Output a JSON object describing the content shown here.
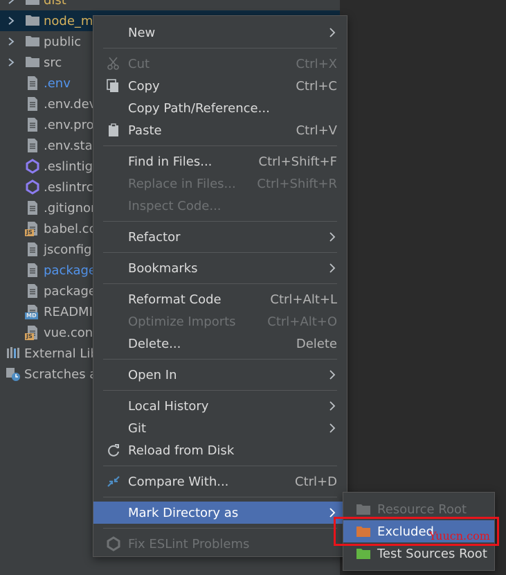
{
  "tree": {
    "rows": [
      {
        "label": "dist",
        "kind": "folder",
        "expand": true
      },
      {
        "label": "node_mo",
        "kind": "folder-excluded",
        "expand": true,
        "selected": true
      },
      {
        "label": "public",
        "kind": "folder",
        "expand": true
      },
      {
        "label": "src",
        "kind": "folder",
        "expand": true
      },
      {
        "label": ".env",
        "kind": "file",
        "link": true
      },
      {
        "label": ".env.deve",
        "kind": "file"
      },
      {
        "label": ".env.proc",
        "kind": "file"
      },
      {
        "label": ".env.stag",
        "kind": "file"
      },
      {
        "label": ".eslintign",
        "kind": "eslint"
      },
      {
        "label": ".eslintrc.",
        "kind": "eslint"
      },
      {
        "label": ".gitignor",
        "kind": "gitignore"
      },
      {
        "label": "babel.co",
        "kind": "js"
      },
      {
        "label": "jsconfig.",
        "kind": "json"
      },
      {
        "label": "package",
        "kind": "json",
        "link": true
      },
      {
        "label": "package",
        "kind": "json"
      },
      {
        "label": "READMI",
        "kind": "md"
      },
      {
        "label": "vue.conf",
        "kind": "js"
      },
      {
        "label": "External Lib",
        "kind": "libs",
        "root": true
      },
      {
        "label": "Scratches ar",
        "kind": "scratches",
        "root": true
      }
    ],
    "badges": {
      "js": "JS",
      "md": "MD"
    }
  },
  "menu": {
    "items": [
      {
        "label": "New",
        "submenu": true
      },
      {
        "sep": true
      },
      {
        "label": "Cut",
        "shortcut": "Ctrl+X",
        "icon": "scissors-icon",
        "disabled": true
      },
      {
        "label": "Copy",
        "shortcut": "Ctrl+C",
        "icon": "copy-icon"
      },
      {
        "label": "Copy Path/Reference..."
      },
      {
        "label": "Paste",
        "shortcut": "Ctrl+V",
        "icon": "clipboard-icon"
      },
      {
        "sep": true
      },
      {
        "label": "Find in Files...",
        "shortcut": "Ctrl+Shift+F"
      },
      {
        "label": "Replace in Files...",
        "shortcut": "Ctrl+Shift+R",
        "disabled": true
      },
      {
        "label": "Inspect Code...",
        "disabled": true
      },
      {
        "sep": true
      },
      {
        "label": "Refactor",
        "submenu": true
      },
      {
        "sep": true
      },
      {
        "label": "Bookmarks",
        "submenu": true
      },
      {
        "sep": true
      },
      {
        "label": "Reformat Code",
        "shortcut": "Ctrl+Alt+L"
      },
      {
        "label": "Optimize Imports",
        "shortcut": "Ctrl+Alt+O",
        "disabled": true
      },
      {
        "label": "Delete...",
        "shortcut": "Delete"
      },
      {
        "sep": true
      },
      {
        "label": "Open In",
        "submenu": true
      },
      {
        "sep": true
      },
      {
        "label": "Local History",
        "submenu": true
      },
      {
        "label": "Git",
        "submenu": true
      },
      {
        "label": "Reload from Disk",
        "icon": "reload-icon"
      },
      {
        "sep": true
      },
      {
        "label": "Compare With...",
        "shortcut": "Ctrl+D",
        "icon": "compare-icon"
      },
      {
        "sep": true
      },
      {
        "label": "Mark Directory as",
        "submenu": true,
        "active": true
      },
      {
        "sep": true
      },
      {
        "label": "Fix ESLint Problems",
        "icon": "eslint-icon",
        "disabled": true
      }
    ]
  },
  "submenu": {
    "items": [
      {
        "label": "Resource Root",
        "icon": "resource-root-icon",
        "color": "#6c6f71",
        "disabled": true
      },
      {
        "label": "Excluded",
        "icon": "excluded-folder-icon",
        "color": "#d6763a",
        "active": true
      },
      {
        "label": "Test Sources Root",
        "icon": "test-sources-folder-icon",
        "color": "#62b543"
      }
    ]
  },
  "watermark": "Yuucn.com",
  "colors": {
    "accent": "#4b6eaf",
    "highlight": "#e8141b",
    "link": "#5394ec",
    "excluded": "#d6b25c"
  }
}
